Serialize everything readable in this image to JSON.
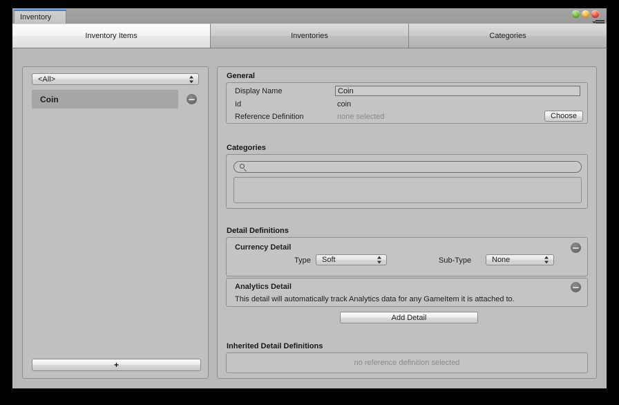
{
  "window": {
    "tab_title": "Inventory",
    "controls": {
      "green": "#72c23d",
      "yellow": "#f4b63b",
      "red": "#ee4f3e"
    },
    "menu_icon": "hamburger-menu-icon"
  },
  "tabs": [
    {
      "label": "Inventory Items",
      "active": true
    },
    {
      "label": "Inventories",
      "active": false
    },
    {
      "label": "Categories",
      "active": false
    }
  ],
  "left_panel": {
    "filter": {
      "selected": "<All>"
    },
    "items": [
      {
        "label": "Coin",
        "selected": true,
        "remove_icon": "minus-circle-icon"
      }
    ],
    "add_button_label": "+"
  },
  "general": {
    "title": "General",
    "display_name_label": "Display Name",
    "display_name_value": "Coin",
    "id_label": "Id",
    "id_value": "coin",
    "reference_definition_label": "Reference Definition",
    "reference_definition_value": "none selected",
    "choose_button_label": "Choose"
  },
  "categories": {
    "title": "Categories",
    "search_placeholder": "",
    "search_value": "",
    "search_icon": "search-icon",
    "list_items": []
  },
  "detail_definitions": {
    "title": "Detail Definitions",
    "details": [
      {
        "name": "Currency Detail",
        "remove_icon": "minus-circle-icon",
        "fields": [
          {
            "label": "Type",
            "value": "Soft"
          },
          {
            "label": "Sub-Type",
            "value": "None"
          }
        ]
      },
      {
        "name": "Analytics Detail",
        "remove_icon": "minus-circle-icon",
        "description": "This detail will automatically track Analytics data for any GameItem it is attached to."
      }
    ],
    "add_detail_button_label": "Add Detail"
  },
  "inherited_detail_definitions": {
    "title": "Inherited Detail Definitions",
    "empty_message": "no reference definition selected"
  }
}
